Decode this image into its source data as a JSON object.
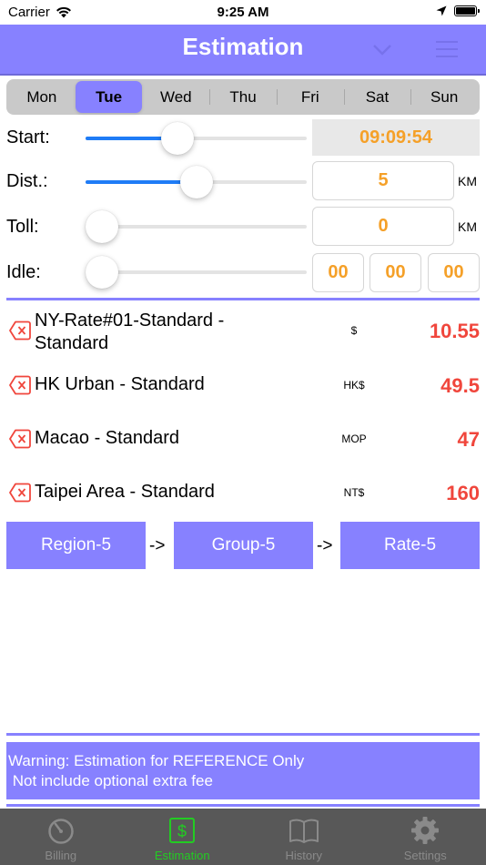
{
  "status_bar": {
    "carrier": "Carrier",
    "time": "9:25 AM"
  },
  "header": {
    "title": "Estimation"
  },
  "days": [
    {
      "label": "Mon",
      "selected": false
    },
    {
      "label": "Tue",
      "selected": true
    },
    {
      "label": "Wed",
      "selected": false
    },
    {
      "label": "Thu",
      "selected": false
    },
    {
      "label": "Fri",
      "selected": false
    },
    {
      "label": "Sat",
      "selected": false
    },
    {
      "label": "Sun",
      "selected": false
    }
  ],
  "inputs": {
    "start": {
      "label": "Start:",
      "value": "09:09:54",
      "slider_fraction": 0.4
    },
    "dist": {
      "label": "Dist.:",
      "value": "5",
      "unit": "KM",
      "slider_fraction": 0.5
    },
    "toll": {
      "label": "Toll:",
      "value": "0",
      "unit": "KM",
      "slider_fraction": 0.0
    },
    "idle": {
      "label": "Idle:",
      "hours": "00",
      "minutes": "00",
      "seconds": "00",
      "slider_fraction": 0.0
    }
  },
  "rates": [
    {
      "name": "NY-Rate#01-Standard - Standard",
      "currency": "$",
      "amount": "10.55"
    },
    {
      "name": "HK Urban - Standard",
      "currency": "HK$",
      "amount": "49.5"
    },
    {
      "name": "Macao - Standard",
      "currency": "MOP",
      "amount": "47"
    },
    {
      "name": "Taipei Area - Standard",
      "currency": "NT$",
      "amount": "160"
    }
  ],
  "flow": {
    "region": "Region-5",
    "group": "Group-5",
    "rate": "Rate-5",
    "arrow": "->"
  },
  "warning": {
    "line1": "Warning: Estimation for REFERENCE Only",
    "line2": " Not include optional extra fee"
  },
  "tabs": [
    {
      "label": "Billing",
      "icon": "timer-icon",
      "active": false
    },
    {
      "label": "Estimation",
      "icon": "dollar-icon",
      "active": true
    },
    {
      "label": "History",
      "icon": "book-icon",
      "active": false
    },
    {
      "label": "Settings",
      "icon": "gear-icon",
      "active": false
    }
  ],
  "colors": {
    "accent": "#8781ff",
    "amount": "#f0463c",
    "value": "#f5a028",
    "slider": "#1f7cf6",
    "tab_active": "#22cc22"
  }
}
